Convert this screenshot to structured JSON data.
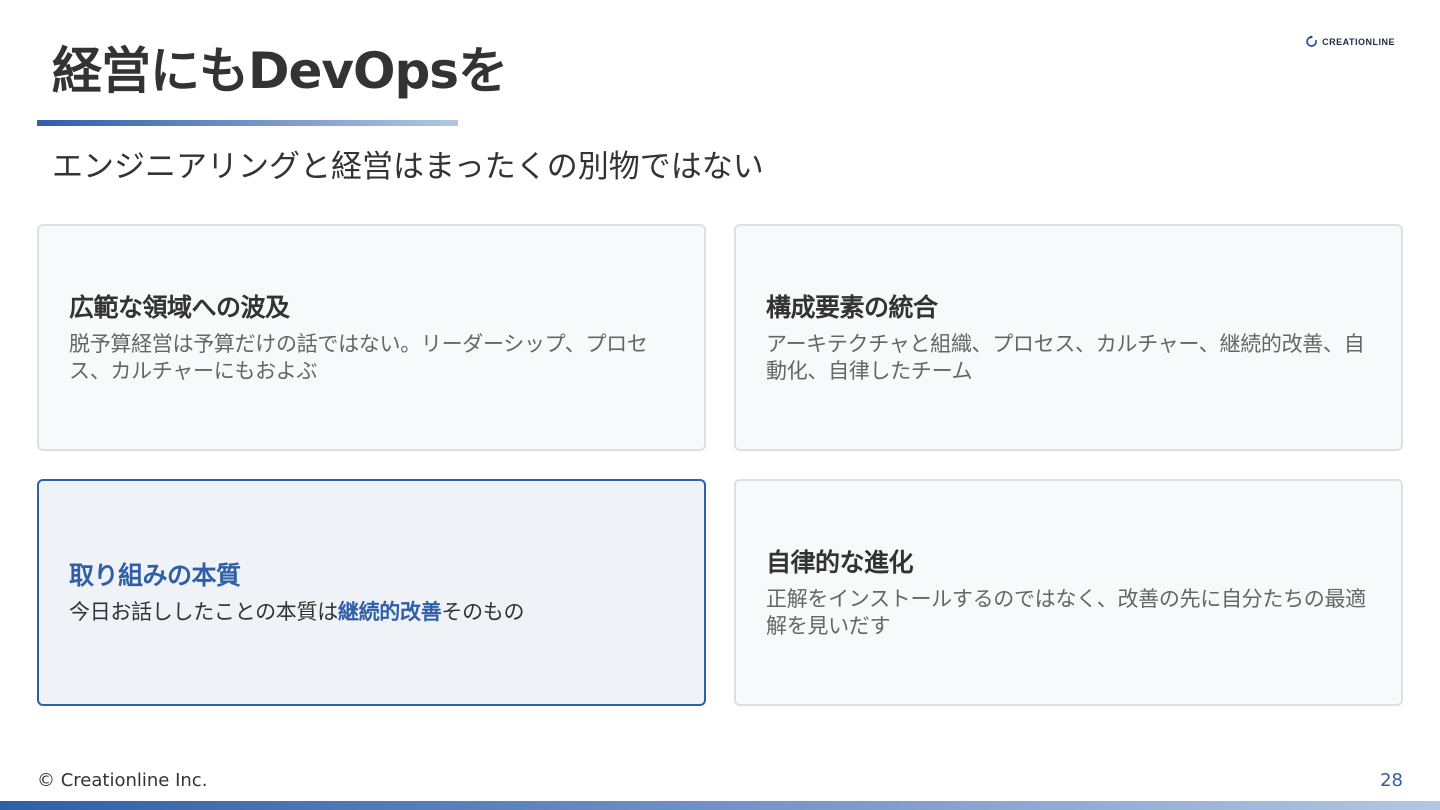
{
  "slide": {
    "title": "経営にもDevOpsを",
    "subtitle": "エンジニアリングと経営はまったくの別物ではない",
    "logo_text": "CREATIONLINE",
    "logo_icon": "circular-arrow-logo-icon"
  },
  "cards": [
    {
      "title": "広範な領域への波及",
      "body": "脱予算経営は予算だけの話ではない。リーダーシップ、プロセス、カルチャーにもおよぶ"
    },
    {
      "title": "構成要素の統合",
      "body": "アーキテクチャと組織、プロセス、カルチャー、継続的改善、自動化、自律したチーム"
    },
    {
      "title": "取り組みの本質",
      "body_prefix": "今日お話ししたことの本質は",
      "body_emphasis": "継続的改善",
      "body_suffix": "そのもの"
    },
    {
      "title": "自律的な進化",
      "body": "正解をインストールするのではなく、改善の先に自分たちの最適解を見いだす"
    }
  ],
  "footer": {
    "copyright": "© Creationline Inc.",
    "page_number": "28"
  },
  "colors": {
    "accent": "#2f5fa6",
    "accent_light": "#b3c6e4",
    "text": "#333333",
    "muted_text": "#666666",
    "card_bg": "#f8f9fa",
    "card_border": "#dcdfe3",
    "highlight_bg": "#eff2f7"
  }
}
